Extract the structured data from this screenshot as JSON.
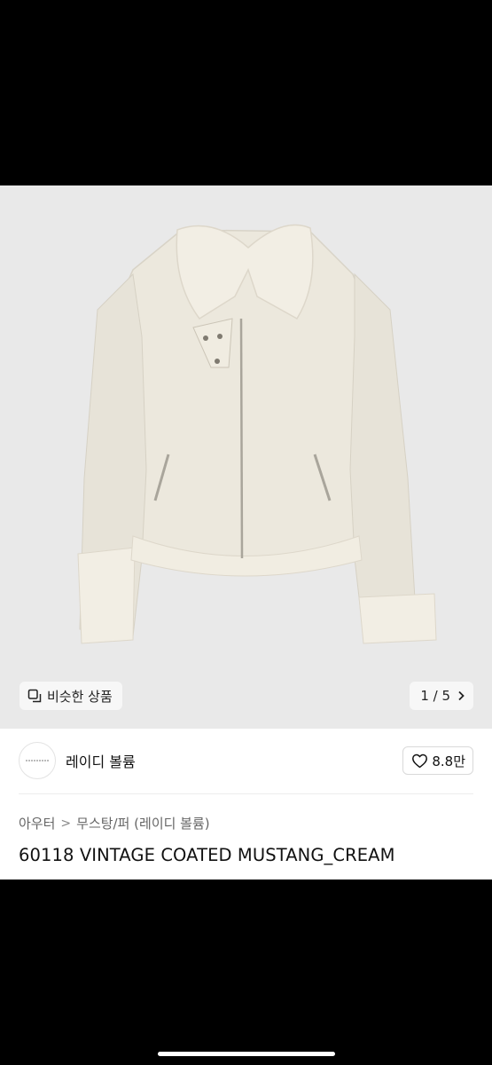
{
  "gallery": {
    "similar_label": "비슷한 상품",
    "page_indicator": "1 / 5",
    "chevron": "›"
  },
  "shop": {
    "name": "레이디 볼륨",
    "likes": "8.8만"
  },
  "breadcrumb": {
    "category": "아우터",
    "separator": ">",
    "subcategory": "무스탕/퍼 (레이디 볼륨)"
  },
  "product": {
    "title": "60118 VINTAGE COATED MUSTANG_CREAM"
  },
  "icons": {
    "similar": "stacked-squares-icon",
    "like": "heart-outline-icon",
    "next": "chevron-right-icon",
    "separator": "chevron-right-small-icon"
  },
  "colors": {
    "jacket": "#ece8dd",
    "shearling": "#f1ede2",
    "image_bg": "#e9e9e9"
  }
}
